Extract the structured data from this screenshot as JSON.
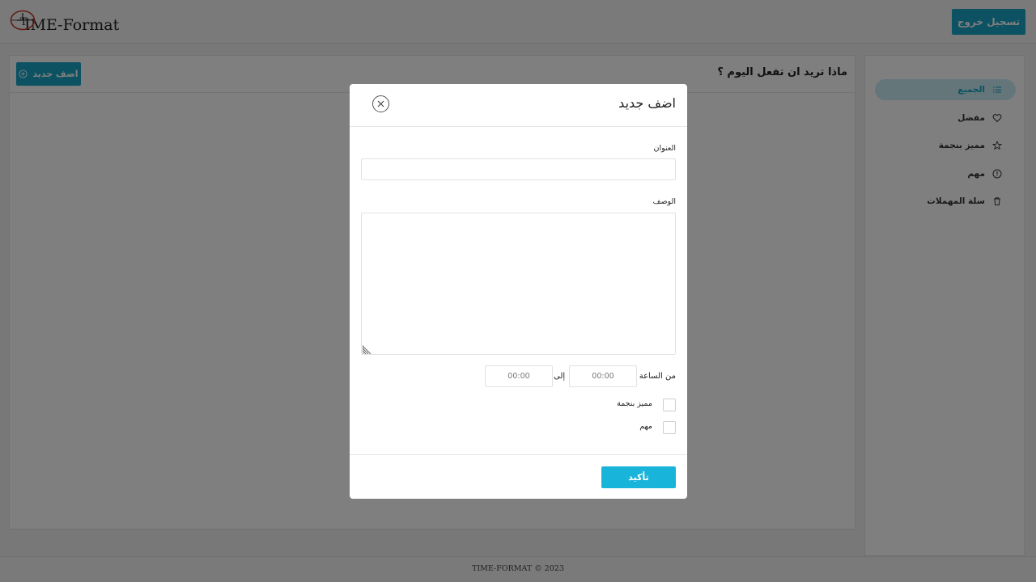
{
  "header": {
    "logo_text": "IME-Format",
    "logout_label": "تسجيل خروج"
  },
  "sidebar": {
    "items": [
      {
        "label": "الجميع",
        "icon": "list-icon",
        "active": true
      },
      {
        "label": "مفضل",
        "icon": "heart-icon",
        "active": false
      },
      {
        "label": "مميز بنجمة",
        "icon": "star-icon",
        "active": false
      },
      {
        "label": "مهم",
        "icon": "alert-circle-icon",
        "active": false
      },
      {
        "label": "سلة المهملات",
        "icon": "trash-icon",
        "active": false
      }
    ]
  },
  "main": {
    "title": "ماذا تريد ان تفعل اليوم ؟",
    "add_label": "اضف جديد"
  },
  "modal": {
    "title": "اضف جديد",
    "title_field_label": "العنوان",
    "title_value": "",
    "description_label": "الوصف",
    "description_value": "",
    "from_label": "من الساعة",
    "from_value": "00:00",
    "to_label": "إلى",
    "to_value": "00:00",
    "starred_label": "مميز بنجمة",
    "important_label": "مهم",
    "confirm_label": "تأكيد"
  },
  "footer": {
    "text": "TIME-FORMAT © 2023"
  },
  "colors": {
    "accent": "#19a4c7",
    "confirm": "#19b4d9",
    "active_bg": "#c9edf5"
  }
}
